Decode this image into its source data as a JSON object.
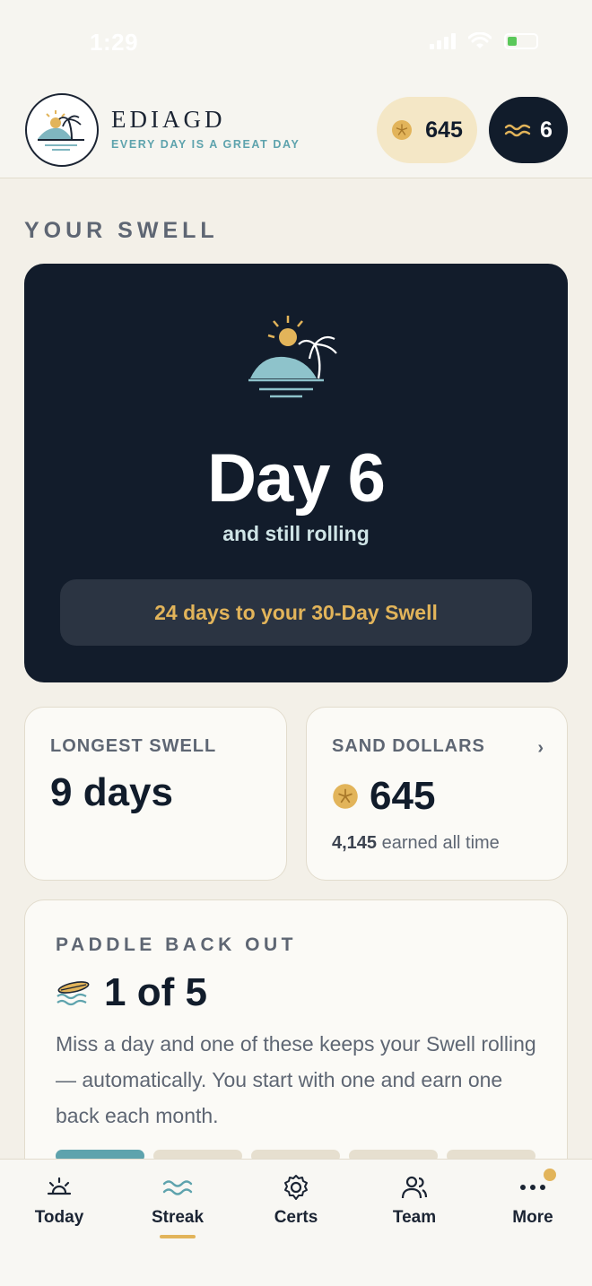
{
  "status_bar": {
    "time": "1:29"
  },
  "header": {
    "brand_name": "EDIAGD",
    "brand_tagline": "EVERY DAY IS A GREAT DAY",
    "coins": "645",
    "streak": "6"
  },
  "section_label": "YOUR SWELL",
  "hero": {
    "day": "Day 6",
    "subtitle": "and still rolling",
    "goal": "24 days to your 30-Day Swell"
  },
  "longest": {
    "label": "LONGEST SWELL",
    "value": "9 days"
  },
  "sand": {
    "label": "SAND DOLLARS",
    "chevron": "›",
    "value": "645",
    "earned_value": "4,145",
    "earned_suffix": " earned all time"
  },
  "paddle": {
    "label": "PADDLE BACK OUT",
    "count": "1 of 5",
    "description": "Miss a day and one of these keeps your Swell rolling — automatically. You start with one and earn one back each month.",
    "filled": 1,
    "total": 5
  },
  "nav": {
    "items": [
      {
        "label": "Today",
        "icon": "sunrise-icon"
      },
      {
        "label": "Streak",
        "icon": "waves-icon"
      },
      {
        "label": "Certs",
        "icon": "gear-icon"
      },
      {
        "label": "Team",
        "icon": "team-icon"
      },
      {
        "label": "More",
        "icon": "more-dots-icon"
      }
    ],
    "active": "Streak"
  },
  "colors": {
    "navy": "#121c2b",
    "gold": "#e2b45a",
    "teal": "#5ea3ad",
    "cream": "#f3f0e8"
  }
}
